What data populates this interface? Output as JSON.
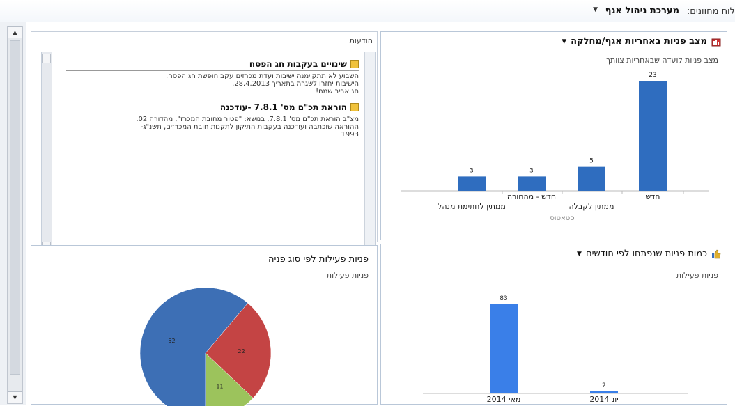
{
  "header": {
    "label": "לוח מחוונים:",
    "title": "מערכת ניהול אגף",
    "dropdown": "▼"
  },
  "icons": {
    "scroll_up": "▲",
    "scroll_down": "▼"
  },
  "panel_status": {
    "title": "מצב פניות באחריות אגף/מחלקה",
    "subtitle": "מצב פניות לועדה שבאחריות צוותך",
    "xlabel": "סטאטוס",
    "chart_data": {
      "type": "bar",
      "categories": [
        "חדש",
        "ממתין לקבלה",
        "חדש - מהחורה",
        "ממתין לחתימת מנהל"
      ],
      "values": [
        23,
        5,
        3,
        3
      ],
      "xlabel": "סטאטוס",
      "color": "#2f6dbf"
    }
  },
  "panel_news": {
    "title": "הודעות",
    "items": [
      {
        "title": "שינויים בעקבות חג הפסח",
        "lines": [
          "השבוע לא תתקיימנה ישיבות ועדת מכרזים עקב חופשת חג הפסח.",
          "הישיבות יחזרו לשגרה בתאריך 28.4.2013.",
          "חג אביב שמח!"
        ]
      },
      {
        "title": "הוראת תכ\"ם מס' 7.8.1 -עודכנה",
        "lines": [
          "מצ\"ב הוראת תכ\"ם מס' 7.8.1, בנושא: \"פטור מחובת המכרז\", מהדורה 02.",
          "ההוראה שוכתבה ועודכנה בעקבות התיקון לתקנות חובת המכרזים, תשנ\"ג-",
          "1993"
        ]
      }
    ]
  },
  "panel_monthly": {
    "title": "כמות פניות  שנפתחו לפי חודשים",
    "subtitle": "פניות פעילות",
    "chart_data": {
      "type": "bar",
      "categories": [
        "מאי 2014",
        "יונ 2014"
      ],
      "values": [
        83,
        2
      ],
      "color": "#3a7fe8"
    }
  },
  "panel_pie": {
    "title": "פניות פעילות לפי סוג פניה",
    "subtitle": "פניות פעילות",
    "chart_data": {
      "type": "pie",
      "values": [
        52,
        22,
        11
      ],
      "colors": [
        "#3d6fb5",
        "#c44444",
        "#9cc35c"
      ]
    }
  }
}
